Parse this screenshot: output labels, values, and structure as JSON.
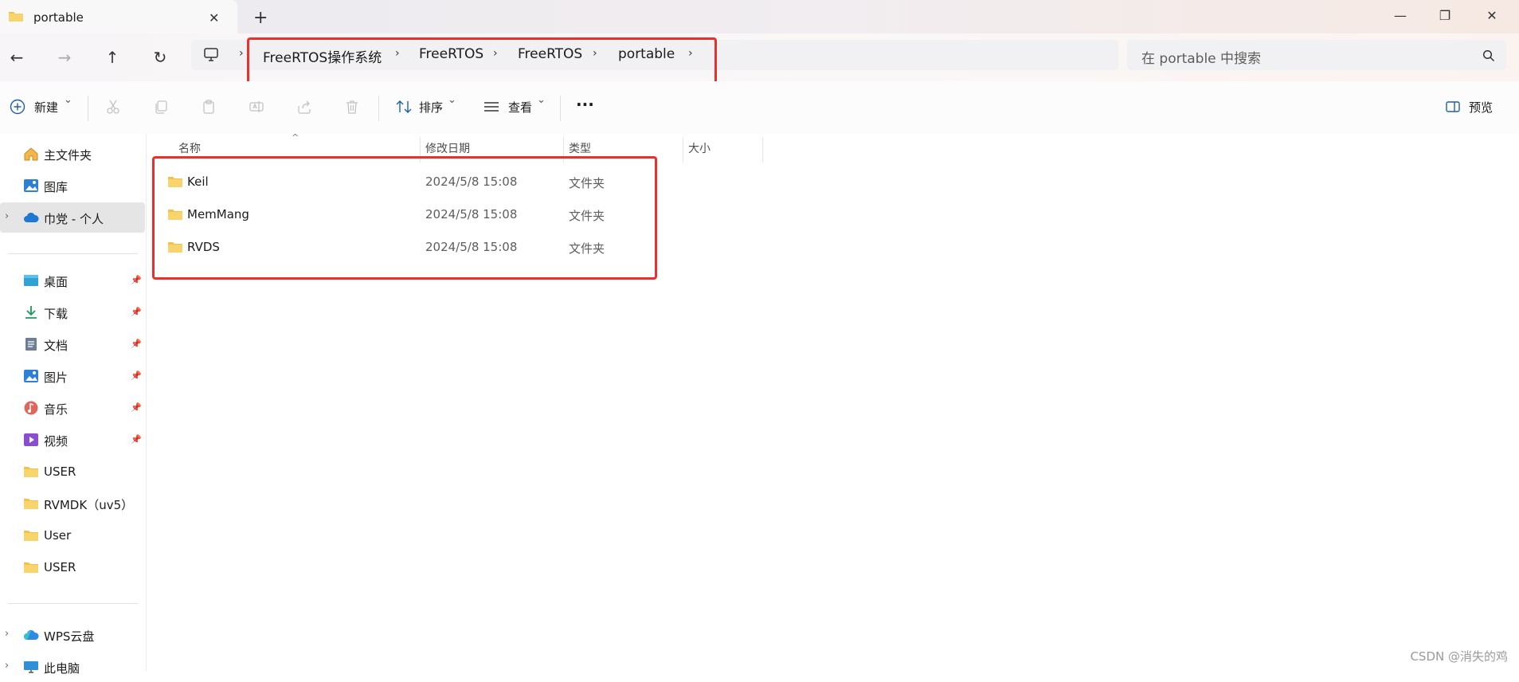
{
  "window": {
    "tab_title": "portable",
    "tab_close": "✕",
    "new_tab": "+",
    "minimize": "—",
    "restore": "❐",
    "close": "✕"
  },
  "nav": {
    "back": "←",
    "forward": "→",
    "up": "↑",
    "refresh": "↻"
  },
  "address": {
    "breadcrumbs": [
      "FreeRTOS操作系统",
      "FreeRTOS",
      "FreeRTOS",
      "portable"
    ],
    "separator": "›"
  },
  "search": {
    "placeholder": "在 portable 中搜索"
  },
  "toolbar": {
    "new_label": "新建",
    "sort_label": "排序",
    "view_label": "查看",
    "more_label": "···",
    "preview_label": "预览",
    "chevron": "⌄"
  },
  "sidebar": {
    "top_items": [
      {
        "label": "主文件夹",
        "icon": "home-icon"
      },
      {
        "label": "图库",
        "icon": "gallery-icon"
      },
      {
        "label": "巾党 - 个人",
        "icon": "onedrive-cloud-icon",
        "selected": true
      }
    ],
    "pinned_items": [
      {
        "label": "桌面",
        "icon": "desktop-icon"
      },
      {
        "label": "下载",
        "icon": "download-icon"
      },
      {
        "label": "文档",
        "icon": "document-icon"
      },
      {
        "label": "图片",
        "icon": "pictures-icon"
      },
      {
        "label": "音乐",
        "icon": "music-icon"
      },
      {
        "label": "视频",
        "icon": "video-icon"
      }
    ],
    "folder_items": [
      {
        "label": "USER"
      },
      {
        "label": "RVMDK（uv5）"
      },
      {
        "label": "User"
      },
      {
        "label": "USER"
      }
    ],
    "bottom_items": [
      {
        "label": "WPS云盘",
        "icon": "wps-cloud-icon"
      },
      {
        "label": "此电脑",
        "icon": "this-pc-icon"
      }
    ],
    "expander": "›",
    "pin": "📌"
  },
  "file_list": {
    "columns": [
      "名称",
      "修改日期",
      "类型",
      "大小"
    ],
    "sort_caret": "^",
    "rows": [
      {
        "name": "Keil",
        "date": "2024/5/8 15:08",
        "type": "文件夹"
      },
      {
        "name": "MemMang",
        "date": "2024/5/8 15:08",
        "type": "文件夹"
      },
      {
        "name": "RVDS",
        "date": "2024/5/8 15:08",
        "type": "文件夹"
      }
    ]
  },
  "watermark": "CSDN @消失的鸡",
  "colors": {
    "highlight": "#e8312e",
    "folder": "#f2c14b",
    "selection": "#e5e5e5"
  }
}
